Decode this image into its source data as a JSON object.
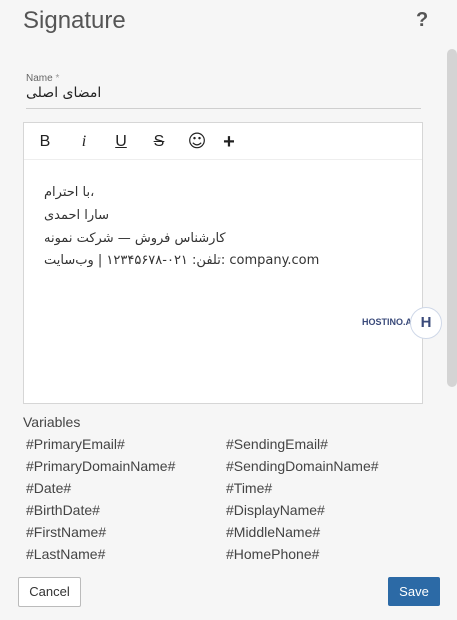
{
  "dialog": {
    "title": "Signature",
    "help_label": "?"
  },
  "name_field": {
    "label": "Name",
    "required_mark": "*",
    "value": "امضای اصلی"
  },
  "toolbar": {
    "bold": "B",
    "italic": "i",
    "underline": "U",
    "strike": "S",
    "emoji": "☺",
    "insert": "+"
  },
  "editor_content": {
    "lines": [
      "با احترام،",
      "سارا احمدی",
      "کارشناس فروش — شرکت نمونه",
      "تلفن: ۰۲۱-۱۲۳۴۵۶۷۸  |  وب‌سایت: company.com"
    ]
  },
  "watermark": {
    "text": "HOSTINO.AI",
    "logo_letter": "H"
  },
  "variables": {
    "title": "Variables",
    "left": [
      "#PrimaryEmail#",
      "#PrimaryDomainName#",
      "#Date#",
      "#BirthDate#",
      "#FirstName#",
      "#LastName#"
    ],
    "right": [
      "#SendingEmail#",
      "#SendingDomainName#",
      "#Time#",
      "#DisplayName#",
      "#MiddleName#",
      "#HomePhone#"
    ]
  },
  "footer": {
    "cancel_label": "Cancel",
    "save_label": "Save"
  },
  "colors": {
    "save_button": "#2c6aa6",
    "background": "#f6f6f6"
  }
}
